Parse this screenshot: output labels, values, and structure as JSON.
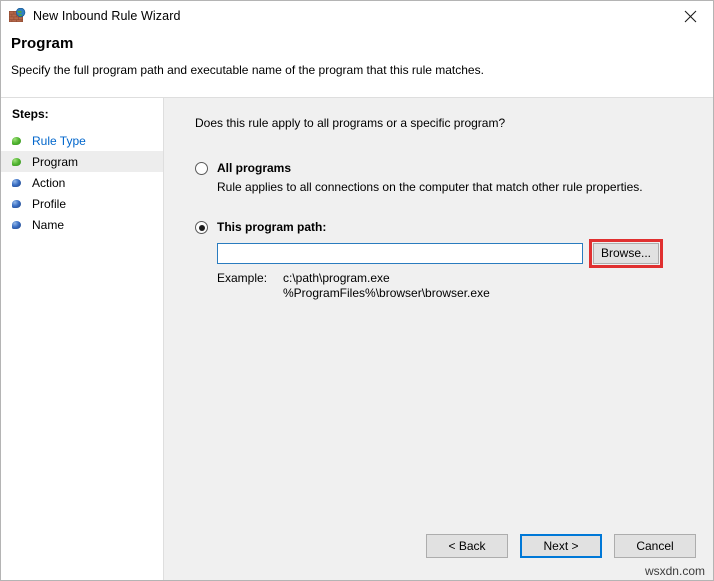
{
  "window": {
    "title": "New Inbound Rule Wizard",
    "icon": "firewall-brick-globe-icon",
    "close_label": "✕"
  },
  "header": {
    "title": "Program",
    "subtitle": "Specify the full program path and executable name of the program that this rule matches."
  },
  "sidebar": {
    "heading": "Steps:",
    "items": [
      {
        "label": "Rule Type",
        "state": "completed",
        "bullet": "green"
      },
      {
        "label": "Program",
        "state": "current",
        "bullet": "green"
      },
      {
        "label": "Action",
        "state": "pending",
        "bullet": "blue"
      },
      {
        "label": "Profile",
        "state": "pending",
        "bullet": "blue"
      },
      {
        "label": "Name",
        "state": "pending",
        "bullet": "blue"
      }
    ]
  },
  "main": {
    "question": "Does this rule apply to all programs or a specific program?",
    "all_programs": {
      "label": "All programs",
      "description": "Rule applies to all connections on the computer that match other rule properties.",
      "selected": false
    },
    "program_path": {
      "label": "This program path:",
      "selected": true,
      "input_value": "",
      "input_placeholder": "",
      "browse_label": "Browse...",
      "example_label": "Example:",
      "example_line1": "c:\\path\\program.exe",
      "example_line2": "%ProgramFiles%\\browser\\browser.exe"
    }
  },
  "footer": {
    "back_label": "< Back",
    "next_label": "Next >",
    "cancel_label": "Cancel",
    "watermark": "wsxdn.com"
  },
  "colors": {
    "link": "#0066CC",
    "annotation": "#E03030",
    "focus": "#0078D7",
    "input_border": "#2A7CBF",
    "content_bg": "#F0F0F0"
  }
}
